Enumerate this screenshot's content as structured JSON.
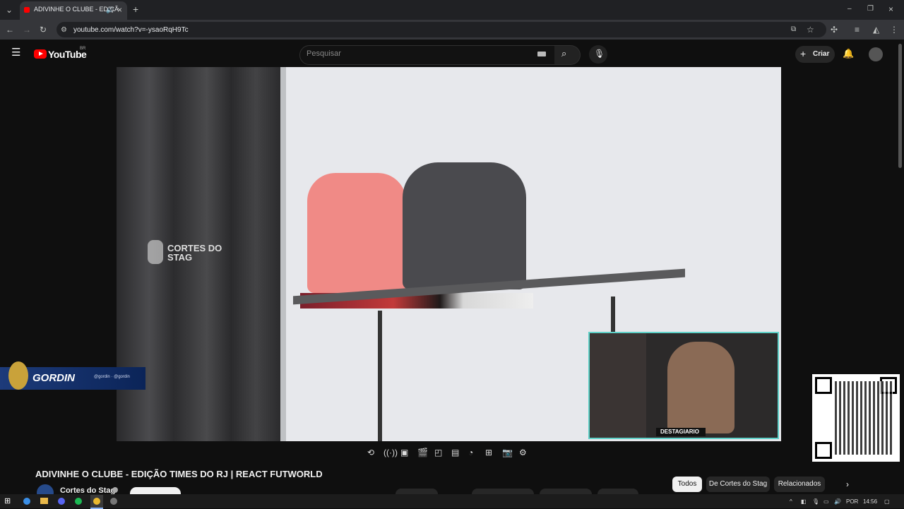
{
  "browser": {
    "tab_title": "ADIVINHE O CLUBE - EDIÇÃ",
    "url": "youtube.com/watch?v=-ysaoRqH9Tc"
  },
  "youtube": {
    "logo_text": "YouTube",
    "region": "BR",
    "search_placeholder": "Pesquisar",
    "create_label": "Criar"
  },
  "video": {
    "watermark": "CORTES DO STAG",
    "overlay_name": "GORDIN",
    "overlay_handles": "@gordin · @gordin",
    "webcam_badge": "DESTAGIARIO"
  },
  "details": {
    "title": "ADIVINHE O CLUBE - EDIÇÃO TIMES DO RJ | REACT FUTWORLD",
    "channel": "Cortes do Stag"
  },
  "chips": [
    "Todos",
    "De Cortes do Stag",
    "Relacionados"
  ],
  "taskbar": {
    "lang": "POR",
    "time": "14:56"
  },
  "colors": {
    "accent": "#ff0000",
    "webcam_border": "#5fd1c8"
  }
}
